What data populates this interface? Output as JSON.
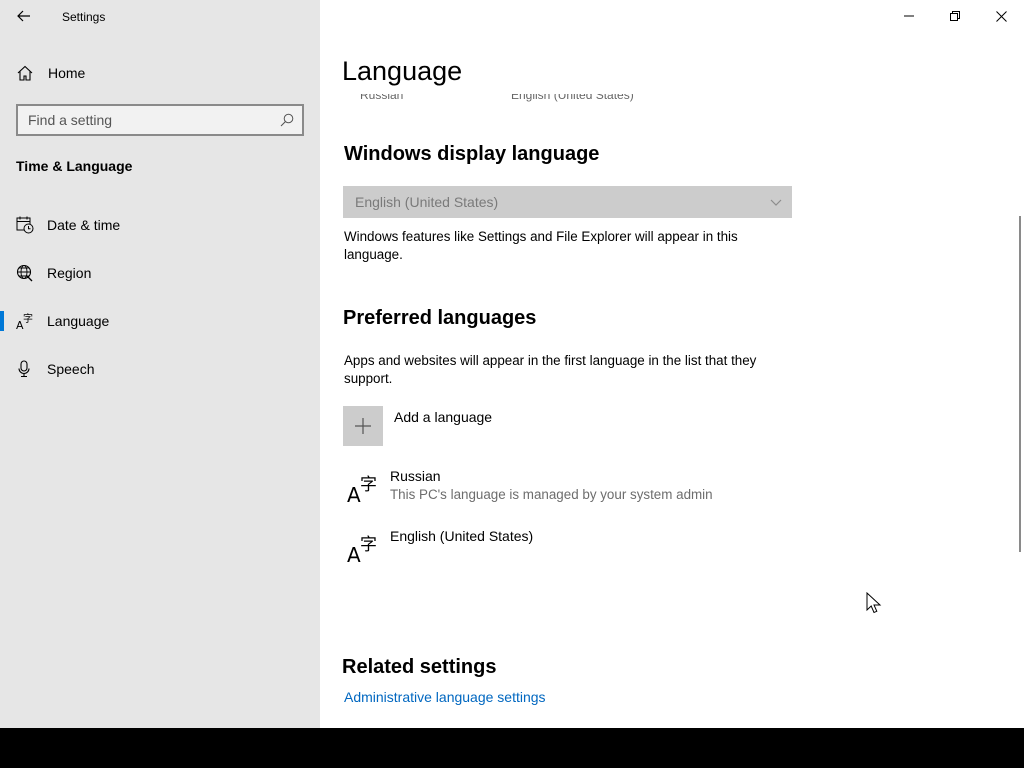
{
  "window": {
    "title": "Settings"
  },
  "sidebar": {
    "home_label": "Home",
    "search_placeholder": "Find a setting",
    "section_title": "Time & Language",
    "items": [
      {
        "label": "Date & time",
        "icon": "calendar-clock-icon"
      },
      {
        "label": "Region",
        "icon": "globe-icon"
      },
      {
        "label": "Language",
        "icon": "language-icon",
        "selected": true
      },
      {
        "label": "Speech",
        "icon": "microphone-icon"
      }
    ]
  },
  "main": {
    "page_title": "Language",
    "cutoff_left": "Russian",
    "cutoff_right": "English (United States)",
    "display_language": {
      "heading": "Windows display language",
      "selected_value": "English (United States)",
      "description": "Windows features like Settings and File Explorer will appear in this language."
    },
    "preferred": {
      "heading": "Preferred languages",
      "description": "Apps and websites will appear in the first language in the list that they support.",
      "add_label": "Add a language",
      "languages": [
        {
          "name": "Russian",
          "note": "This PC's language is managed by your system admin"
        },
        {
          "name": "English (United States)",
          "note": ""
        }
      ]
    },
    "related": {
      "heading": "Related settings",
      "link": "Administrative language settings"
    }
  },
  "colors": {
    "accent": "#0078d7",
    "link": "#0067c0",
    "sidebar_bg": "#e6e6e6",
    "disabled_bg": "#cccccc"
  }
}
